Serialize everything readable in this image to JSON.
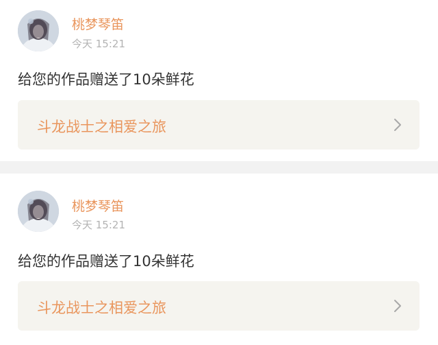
{
  "feed": {
    "items": [
      {
        "username": "桃梦琴笛",
        "time": "今天 15:21",
        "message": "给您的作品赠送了10朵鲜花",
        "work_title": "斗龙战士之相爱之旅",
        "avatar_icon": "user-avatar",
        "chevron_icon": "chevron-right-icon"
      },
      {
        "username": "桃梦琴笛",
        "time": "今天 15:21",
        "message": "给您的作品赠送了10朵鲜花",
        "work_title": "斗龙战士之相爱之旅",
        "avatar_icon": "user-avatar",
        "chevron_icon": "chevron-right-icon"
      }
    ]
  },
  "colors": {
    "accent": "#e9955c",
    "time_gray": "#b3b3b3",
    "message_text": "#333333",
    "link_bg": "#f5f4ef",
    "separator": "#f2f2f2"
  }
}
